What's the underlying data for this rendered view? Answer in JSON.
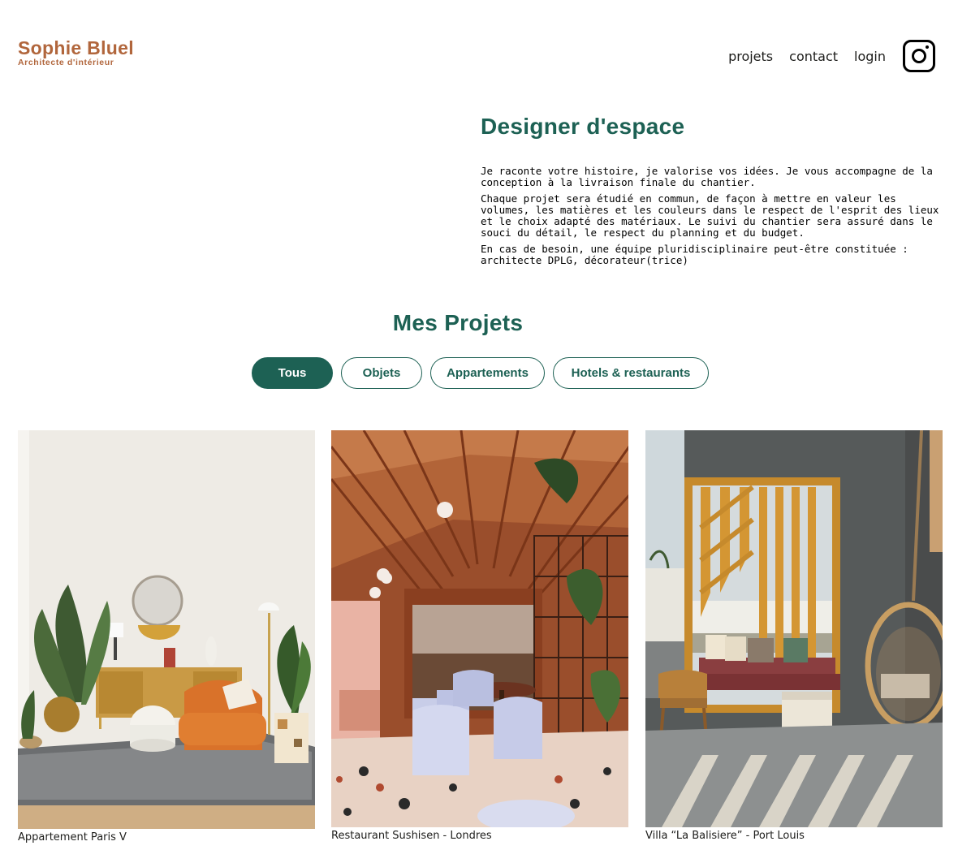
{
  "logo": {
    "name": "Sophie Bluel",
    "subtitle": "Architecte d'intérieur"
  },
  "nav": {
    "items": [
      "projets",
      "contact",
      "login"
    ],
    "instagram_icon": "instagram-icon"
  },
  "intro": {
    "title": "Designer d'espace",
    "paragraphs": [
      "Je raconte votre histoire, je valorise vos idées. Je vous accompagne de la conception à la livraison finale du chantier.",
      "Chaque projet sera étudié en commun, de façon à mettre en valeur les volumes, les matières et les couleurs dans le respect de l'esprit des lieux et le choix adapté des matériaux. Le suivi du chantier sera assuré dans le souci du détail, le respect du planning et du budget.",
      "En cas de besoin, une équipe pluridisciplinaire peut-être constituée : architecte DPLG, décorateur(trice)"
    ]
  },
  "projects": {
    "title": "Mes Projets",
    "filters": [
      "Tous",
      "Objets",
      "Appartements",
      "Hotels & restaurants"
    ],
    "active_filter": "Tous",
    "items": [
      {
        "caption": "Appartement Paris V"
      },
      {
        "caption": "Restaurant Sushisen - Londres"
      },
      {
        "caption": "Villa “La Balisiere” - Port Louis"
      }
    ]
  },
  "colors": {
    "brand": "#b1663c",
    "accent": "#1d6154"
  }
}
